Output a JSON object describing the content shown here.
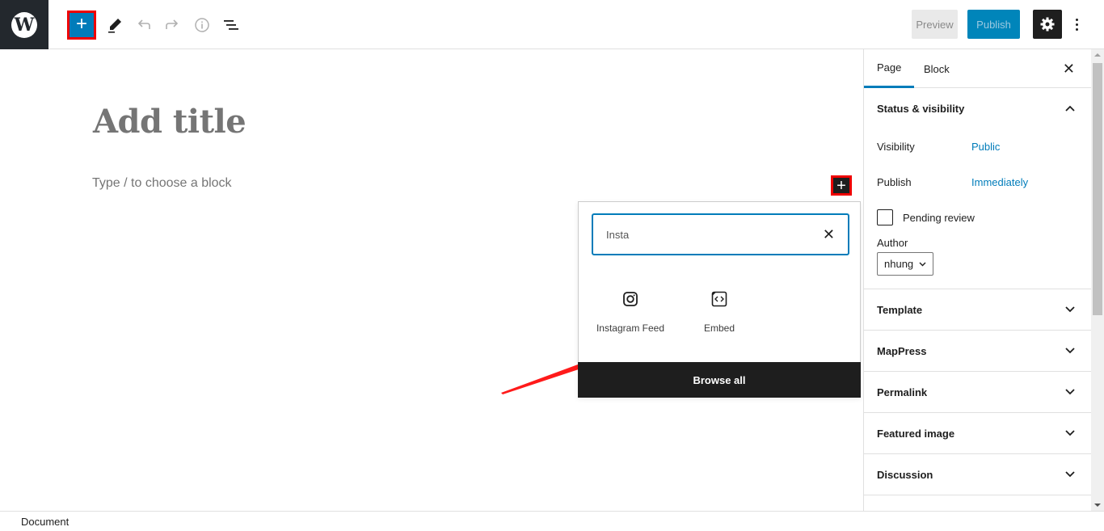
{
  "topbar": {
    "logo": "W",
    "inserter_icon": "+",
    "tools": [
      "pencil-icon",
      "undo-icon",
      "redo-icon",
      "info-icon",
      "list-view-icon"
    ],
    "preview_label": "Preview",
    "publish_label": "Publish"
  },
  "editor": {
    "title_placeholder": "Add title",
    "block_placeholder": "Type / to choose a block",
    "block_plus": "+"
  },
  "inserter": {
    "search_value": "Insta",
    "clear_icon": "✕",
    "results": [
      {
        "label": "Instagram Feed",
        "icon": "instagram-icon"
      },
      {
        "label": "Embed",
        "icon": "embed-icon"
      }
    ],
    "browse_all_label": "Browse all"
  },
  "sidebar": {
    "tabs": [
      {
        "label": "Page",
        "active": true
      },
      {
        "label": "Block",
        "active": false
      }
    ],
    "close_icon": "✕",
    "status_panel": {
      "title": "Status & visibility",
      "visibility_label": "Visibility",
      "visibility_value": "Public",
      "publish_label": "Publish",
      "publish_value": "Immediately",
      "pending_label": "Pending review",
      "pending_checked": false,
      "author_label": "Author",
      "author_value": "nhung"
    },
    "panels": [
      {
        "title": "Template"
      },
      {
        "title": "MapPress"
      },
      {
        "title": "Permalink"
      },
      {
        "title": "Featured image"
      },
      {
        "title": "Discussion"
      }
    ]
  },
  "footer": {
    "breadcrumb": "Document"
  },
  "colors": {
    "accent": "#007cba",
    "highlight": "#ee0000",
    "dark": "#1e1e1e"
  }
}
